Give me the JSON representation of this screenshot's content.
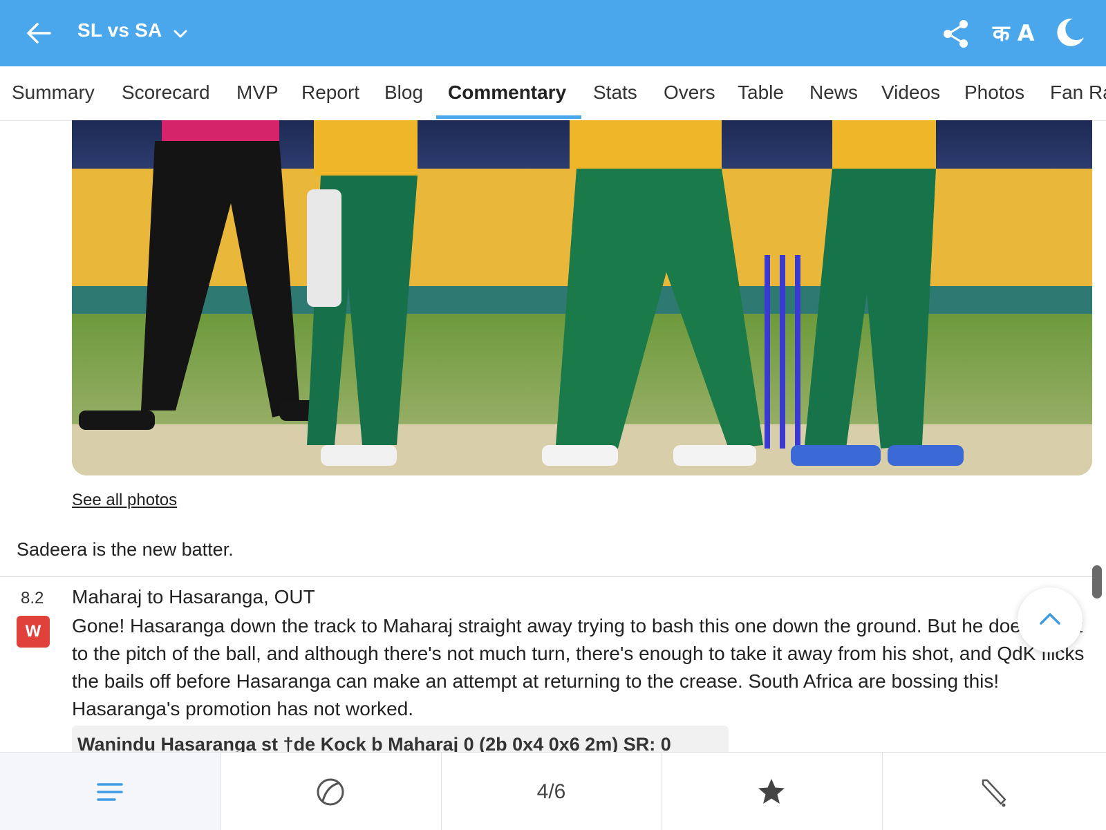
{
  "header": {
    "title": "SL vs SA",
    "lang_label": "क A"
  },
  "tabs": [
    {
      "label": "Summary"
    },
    {
      "label": "Scorecard"
    },
    {
      "label": "MVP"
    },
    {
      "label": "Report"
    },
    {
      "label": "Blog"
    },
    {
      "label": "Commentary",
      "active": true
    },
    {
      "label": "Stats"
    },
    {
      "label": "Overs"
    },
    {
      "label": "Table"
    },
    {
      "label": "News"
    },
    {
      "label": "Videos"
    },
    {
      "label": "Photos"
    },
    {
      "label": "Fan Ra"
    }
  ],
  "feed": {
    "see_all_photos": "See all photos",
    "new_batter_note": "Sadeera is the new batter.",
    "ball": {
      "over": "8.2",
      "badge": "W",
      "headline": "Maharaj to Hasaranga, OUT",
      "text": "Gone! Hasaranga down the track to Maharaj straight away trying to bash this one down the ground. But he doesn't get to the pitch of the ball, and although there's not much turn, there's enough to take it away from his shot, and QdK flicks the bails off before Hasaranga can make an attempt at returning to the crease. South Africa are bossing this! Hasaranga's promotion has not worked.",
      "dismissal": "Wanindu Hasaranga st †de Kock b Maharaj 0 (2b 0x4 0x6 2m) SR: 0"
    }
  },
  "bottom_nav": {
    "items": [
      {
        "icon": "list-icon"
      },
      {
        "icon": "ball-icon"
      },
      {
        "label": "4/6"
      },
      {
        "icon": "star-icon"
      },
      {
        "icon": "bat-icon"
      }
    ]
  },
  "colors": {
    "header_bg": "#4aa7ec",
    "tab_active": "#4aa7ec",
    "wicket_badge": "#e0413b"
  }
}
